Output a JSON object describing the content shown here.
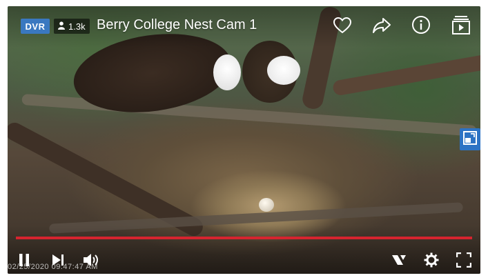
{
  "header": {
    "dvr_label": "DVR",
    "viewer_count": "1.3k",
    "title": "Berry College Nest Cam 1"
  },
  "icons": {
    "favorite": "heart-icon",
    "share": "share-icon",
    "info": "info-icon",
    "playlist": "playlist-icon",
    "side": "picture-in-picture-icon",
    "play_pause": "pause-icon",
    "skip": "skip-next-icon",
    "volume": "volume-icon",
    "clip": "clip-icon",
    "settings": "gear-icon",
    "fullscreen": "fullscreen-icon"
  },
  "player": {
    "timestamp": "02/25/2020 09:47:47 AM",
    "progress": 1.0
  },
  "colors": {
    "dvr_badge": "#3a78c0",
    "progress": "#d6242f",
    "side_button": "#2d73c4"
  }
}
